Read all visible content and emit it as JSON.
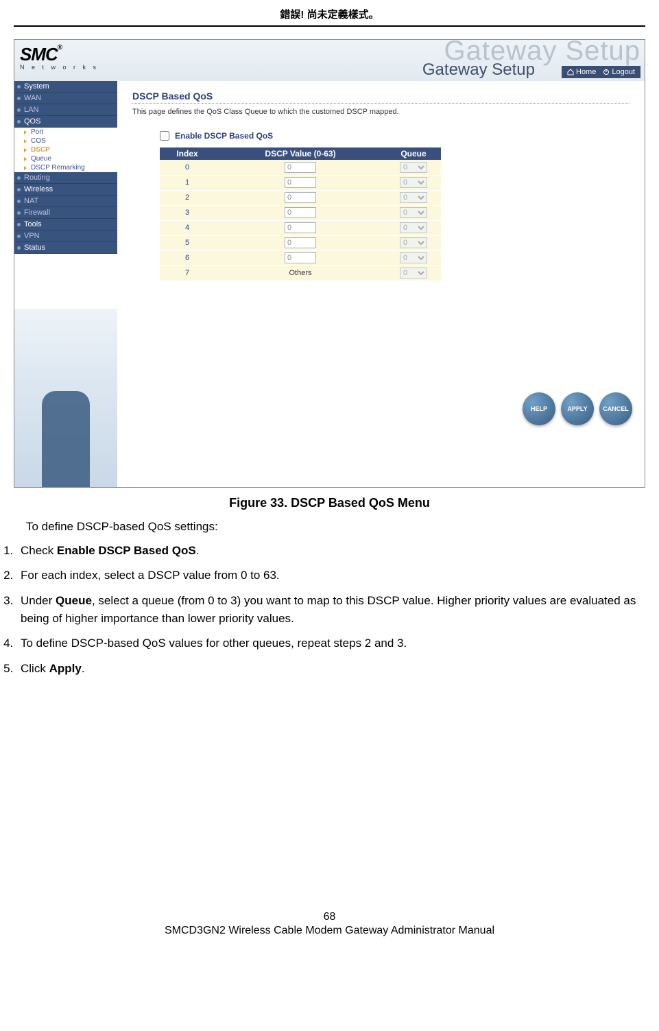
{
  "doc_header": "錯誤! 尚未定義樣式。",
  "screenshot": {
    "logo_main": "SMC",
    "logo_reg": "®",
    "logo_sub": "N e t w o r k s",
    "ghost": "Gateway Setup",
    "banner": "Gateway Setup",
    "top_home": "Home",
    "top_logout": "Logout",
    "nav": {
      "system": "System",
      "wan": "WAN",
      "lan": "LAN",
      "qos": "QOS",
      "sub_port": "Port",
      "sub_cos": "COS",
      "sub_dscp": "DSCP",
      "sub_queue": "Queue",
      "sub_dscp_rem": "DSCP Remarking",
      "routing": "Routing",
      "wireless": "Wireless",
      "nat": "NAT",
      "firewall": "Firewall",
      "tools": "Tools",
      "vpn": "VPN",
      "status": "Status"
    },
    "panel": {
      "heading": "DSCP Based QoS",
      "desc": "This page defines the QoS Class Queue to which the customed DSCP mapped.",
      "enable_label": "Enable DSCP Based QoS",
      "th_index": "Index",
      "th_dscp": "DSCP Value (0-63)",
      "th_queue": "Queue",
      "rows": [
        {
          "idx": "0",
          "dscp": "0",
          "q": "0"
        },
        {
          "idx": "1",
          "dscp": "0",
          "q": "0"
        },
        {
          "idx": "2",
          "dscp": "0",
          "q": "0"
        },
        {
          "idx": "3",
          "dscp": "0",
          "q": "0"
        },
        {
          "idx": "4",
          "dscp": "0",
          "q": "0"
        },
        {
          "idx": "5",
          "dscp": "0",
          "q": "0"
        },
        {
          "idx": "6",
          "dscp": "0",
          "q": "0"
        },
        {
          "idx": "7",
          "dscp": "Others",
          "q": "0"
        }
      ],
      "btn_help": "HELP",
      "btn_apply": "APPLY",
      "btn_cancel": "CANCEL"
    }
  },
  "caption": "Figure 33. DSCP Based QoS Menu",
  "intro": "To define DSCP-based QoS settings:",
  "steps": {
    "s1_a": "Check ",
    "s1_b": "Enable DSCP Based QoS",
    "s1_c": ".",
    "s2": "For each index, select a DSCP value from 0 to 63.",
    "s3_a": "Under ",
    "s3_b": "Queue",
    "s3_c": ", select a queue (from 0 to 3) you want to map to this DSCP value. Higher priority values are evaluated as being of higher importance than lower priority values.",
    "s4": "To define DSCP-based QoS values for other queues, repeat steps 2 and 3.",
    "s5_a": "Click ",
    "s5_b": "Apply",
    "s5_c": "."
  },
  "footer": {
    "page": "68",
    "title": "SMCD3GN2 Wireless Cable Modem Gateway Administrator Manual"
  }
}
